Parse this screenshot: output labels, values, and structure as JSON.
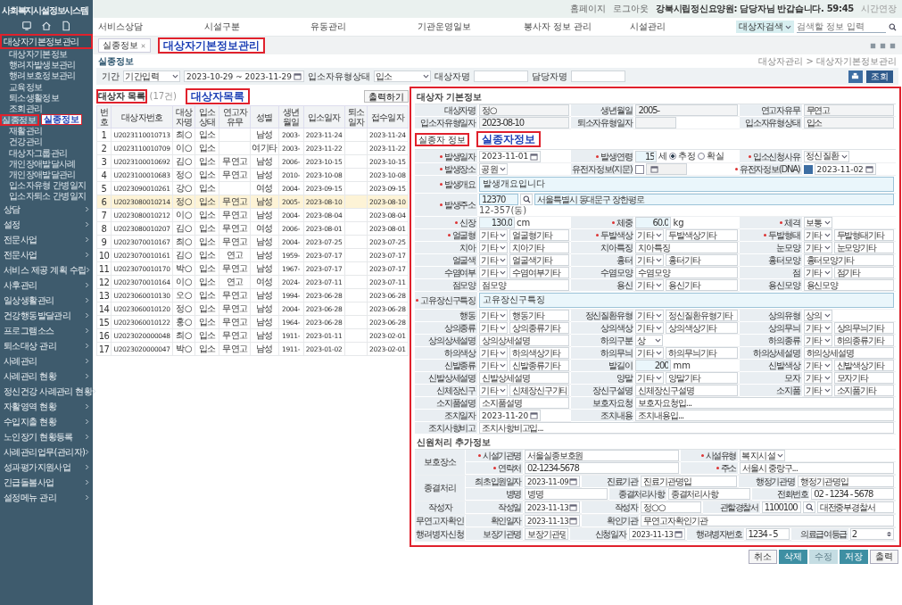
{
  "sidebar": {
    "title": "사회복지시설정보시스템",
    "items": [
      {
        "label": "대상자기본정보관리",
        "expanded": true,
        "selected": false,
        "highlighted": true,
        "callout": "대상자기본정보관리",
        "children": [
          {
            "label": "대상자기본정보",
            "selected": false,
            "highlighted": false
          },
          {
            "label": "행려자발생보관리",
            "selected": false,
            "highlighted": false
          },
          {
            "label": "행려보호정보관리",
            "selected": false,
            "highlighted": false
          },
          {
            "label": "교육정보",
            "selected": false,
            "highlighted": false
          },
          {
            "label": "퇴소생활정보",
            "selected": false,
            "highlighted": false
          },
          {
            "label": "조회관리",
            "selected": false,
            "highlighted": false
          },
          {
            "label": "실종정보",
            "selected": true,
            "highlighted": true,
            "callout": "실종정보"
          },
          {
            "label": "재활관리",
            "selected": false,
            "highlighted": false
          },
          {
            "label": "건강관리",
            "selected": false,
            "highlighted": false
          },
          {
            "label": "대상자그룹관리",
            "selected": false,
            "highlighted": false
          },
          {
            "label": "개인장애발달사례",
            "selected": false,
            "highlighted": false
          },
          {
            "label": "개인장애발달관리",
            "selected": false,
            "highlighted": false
          },
          {
            "label": "입소자유형 간병일지",
            "selected": false,
            "highlighted": false
          },
          {
            "label": "입소자퇴소 간병일지",
            "selected": false,
            "highlighted": false
          }
        ]
      },
      {
        "label": "상담",
        "expanded": false,
        "selected": false,
        "highlighted": false
      },
      {
        "label": "설정",
        "expanded": false,
        "selected": false,
        "highlighted": false
      },
      {
        "label": "전문사업",
        "expanded": false,
        "selected": false,
        "highlighted": false
      },
      {
        "label": "전문사업",
        "expanded": false,
        "selected": false,
        "highlighted": false
      },
      {
        "label": "서비스 제공 계획 수립",
        "expanded": false,
        "selected": false,
        "highlighted": false
      },
      {
        "label": "사후관리",
        "expanded": false,
        "selected": false,
        "highlighted": false
      },
      {
        "label": "일상생활관리",
        "expanded": false,
        "selected": false,
        "highlighted": false
      },
      {
        "label": "건강행동발달관리",
        "expanded": false,
        "selected": false,
        "highlighted": false
      },
      {
        "label": "프로그램소스",
        "expanded": false,
        "selected": false,
        "highlighted": false
      },
      {
        "label": "퇴소대상 관리",
        "expanded": false,
        "selected": false,
        "highlighted": false
      },
      {
        "label": "사례관리",
        "expanded": false,
        "selected": false,
        "highlighted": false
      },
      {
        "label": "사례관리 현황",
        "expanded": false,
        "selected": false,
        "highlighted": false
      },
      {
        "label": "정신건강 사례관리 현황",
        "expanded": false,
        "selected": false,
        "highlighted": false
      },
      {
        "label": "자활영역 현황",
        "expanded": false,
        "selected": false,
        "highlighted": false
      },
      {
        "label": "수입지출 현황",
        "expanded": false,
        "selected": false,
        "highlighted": false
      },
      {
        "label": "노인장기 현황등록",
        "expanded": false,
        "selected": false,
        "highlighted": false
      },
      {
        "label": "사례관리업무(관리자)",
        "expanded": false,
        "selected": false,
        "highlighted": false
      },
      {
        "label": "성과평가지원사업",
        "expanded": false,
        "selected": false,
        "highlighted": false
      },
      {
        "label": "긴급돌봄사업",
        "expanded": false,
        "selected": false,
        "highlighted": false
      },
      {
        "label": "설정메뉴 관리",
        "expanded": false,
        "selected": false,
        "highlighted": false
      }
    ]
  },
  "header": {
    "links": [
      "홈페이지",
      "로그아웃"
    ],
    "user": "강북시립정신요양원: 담당자님 반갑습니다. 59:45",
    "extend": "시간연장"
  },
  "nav": {
    "items": [
      "서비스상담",
      "시설구분",
      "유동관리",
      "기관운영일보",
      "봉사자 정보 관리",
      "시설관리"
    ],
    "search": {
      "scope": "대상자검색",
      "placeholder": "검색할 정보 입력"
    }
  },
  "tabs": [
    {
      "label": "실종정보",
      "selected": true
    }
  ],
  "page": {
    "title": "실종정보",
    "breadcrumb": "대상자관리 > 대상자기본정보관리"
  },
  "filter": {
    "period_label": "기간",
    "period": "기간입력",
    "date_range": "2023-10-29 ~ 2023-11-29",
    "status_label": "입소자유형상태",
    "status": "입소",
    "name_label": "대상자명",
    "manager_label": "담당자명",
    "search_button": "조회"
  },
  "list": {
    "title": "대상자 목록",
    "count": "(17건)",
    "highlighted": true,
    "callout": "대상자목록",
    "print_button": "출력하기",
    "columns": [
      "번호",
      "대상자번호",
      "대상자명",
      "입소상태",
      "연고자유무",
      "성별",
      "생년월일",
      "입소일자",
      "퇴소일자",
      "접수일자"
    ],
    "rows": [
      {
        "cells": [
          "1",
          "U2023110010713",
          "최○",
          "입소",
          "",
          "남성",
          "2003-",
          "2023-11-24",
          "",
          "2023-11-24"
        ],
        "selected": false
      },
      {
        "cells": [
          "2",
          "U2023110010709",
          "이○",
          "입소",
          "",
          "여기타",
          "2003-",
          "2023-11-22",
          "",
          "2023-11-22"
        ],
        "selected": false
      },
      {
        "cells": [
          "3",
          "U2023100010692",
          "김○",
          "입소",
          "무연고",
          "남성",
          "2006-",
          "2023-10-15",
          "",
          "2023-10-15"
        ],
        "selected": false
      },
      {
        "cells": [
          "4",
          "U2023100010683",
          "정○",
          "입소",
          "무연고",
          "남성",
          "2010-",
          "2023-10-08",
          "",
          "2023-10-08"
        ],
        "selected": false
      },
      {
        "cells": [
          "5",
          "U2023090010261",
          "강○",
          "입소",
          "",
          "여성",
          "2004-",
          "2023-09-15",
          "",
          "2023-09-15"
        ],
        "selected": false
      },
      {
        "cells": [
          "6",
          "U2023080010214",
          "정○",
          "입소",
          "무연고",
          "남성",
          "2005-",
          "2023-08-10",
          "",
          "2023-08-10"
        ],
        "selected": true
      },
      {
        "cells": [
          "7",
          "U2023080010212",
          "이○",
          "입소",
          "무연고",
          "남성",
          "2004-",
          "2023-08-04",
          "",
          "2023-08-04"
        ],
        "selected": false
      },
      {
        "cells": [
          "8",
          "U2023080010207",
          "김○",
          "입소",
          "무연고",
          "여성",
          "2006-",
          "2023-08-01",
          "",
          "2023-08-01"
        ],
        "selected": false
      },
      {
        "cells": [
          "9",
          "U2023070010167",
          "최○",
          "입소",
          "무연고",
          "남성",
          "2004-",
          "2023-07-25",
          "",
          "2023-07-25"
        ],
        "selected": false
      },
      {
        "cells": [
          "10",
          "U2023070010161",
          "김○",
          "입소",
          "연고",
          "남성",
          "1959-",
          "2023-07-17",
          "",
          "2023-07-17"
        ],
        "selected": false
      },
      {
        "cells": [
          "11",
          "U2023070010170",
          "박○",
          "입소",
          "무연고",
          "남성",
          "1967-",
          "2023-07-17",
          "",
          "2023-07-17"
        ],
        "selected": false
      },
      {
        "cells": [
          "12",
          "U2023070010164",
          "이○",
          "입소",
          "연고",
          "여성",
          "2024-",
          "2023-07-11",
          "",
          "2023-07-11"
        ],
        "selected": false
      },
      {
        "cells": [
          "13",
          "U2023060010130",
          "오○",
          "입소",
          "무연고",
          "남성",
          "1994-",
          "2023-06-28",
          "",
          "2023-06-28"
        ],
        "selected": false
      },
      {
        "cells": [
          "14",
          "U2023060010120",
          "정○",
          "입소",
          "무연고",
          "남성",
          "2004-",
          "2023-06-28",
          "",
          "2023-06-28"
        ],
        "selected": false
      },
      {
        "cells": [
          "15",
          "U2023060010122",
          "홍○",
          "입소",
          "무연고",
          "남성",
          "1964-",
          "2023-06-28",
          "",
          "2023-06-28"
        ],
        "selected": false
      },
      {
        "cells": [
          "16",
          "U2023020000048",
          "최○",
          "입소",
          "무연고",
          "남성",
          "1911-",
          "2023-01-11",
          "",
          "2023-02-01"
        ],
        "selected": false
      },
      {
        "cells": [
          "17",
          "U2023020000047",
          "박○",
          "입소",
          "무연고",
          "남성",
          "1911-",
          "2023-01-02",
          "",
          "2023-02-01"
        ],
        "selected": false
      }
    ]
  },
  "detail": {
    "highlighted": true,
    "basic_title": "대상자 기본정보",
    "basic_rows": [
      [
        {
          "label": "대상자명",
          "value": "정○"
        },
        {
          "label": "생년월일",
          "value": "2005-"
        },
        {
          "label": "연고자유무",
          "value": "무연고"
        }
      ],
      [
        {
          "label": "입소자유형일자",
          "value": "2023-08-10"
        },
        {
          "label": "퇴소자유형일자"
        },
        {
          "label": "입소자유형상태",
          "value": "입소"
        }
      ]
    ],
    "tab": {
      "label": "실종자 정보",
      "highlighted": true,
      "callout": "실종자정보"
    },
    "rows": [
      [
        {
          "label": "발생일자",
          "required": true,
          "kind": "date",
          "value": "2023-11-01"
        },
        {
          "label": "발생연령",
          "required": true,
          "kind": "age",
          "value": "15",
          "unit": "세",
          "options": [
            {
              "label": "추정",
              "selected": true
            },
            {
              "label": "확실",
              "selected": false
            }
          ]
        },
        {
          "label": "입소신청사유",
          "required": true,
          "kind": "select",
          "value": "정신질환"
        }
      ],
      [
        {
          "label": "발생장소",
          "required": true,
          "kind": "select",
          "value": "공원"
        },
        {
          "label": "유전자정보(지문)",
          "kind": "check_date",
          "checked": false
        },
        {
          "label": "유전자정보(DNA)",
          "required": true,
          "kind": "check_date",
          "checked": true,
          "value": "2023-11-02"
        }
      ],
      [
        {
          "label": "발생개요",
          "required": true,
          "kind": "textarea",
          "value": "발생개요입니다"
        }
      ],
      [
        {
          "label": "발생주소",
          "required": true,
          "kind": "address",
          "zip": "12370",
          "value": "서울특별시 동대문구 장한평로",
          "detail": "12-357(동)"
        }
      ],
      [
        {
          "label": "신장",
          "required": true,
          "kind": "number",
          "value": "130.0",
          "unit": "cm"
        },
        {
          "label": "체중",
          "required": true,
          "kind": "number",
          "value": "60.0",
          "unit": "kg"
        },
        {
          "label": "체격",
          "required": true,
          "kind": "select",
          "value": "보통"
        }
      ],
      [
        {
          "label": "얼굴형",
          "required": true,
          "kind": "select_text",
          "value": "기타",
          "text": "얼굴형기타"
        },
        {
          "label": "두발색상",
          "required": true,
          "kind": "select_text",
          "value": "기타",
          "text": "두발색상기타"
        },
        {
          "label": "두발형태",
          "required": true,
          "kind": "select_text",
          "value": "기타",
          "text": "두발형태기타"
        }
      ],
      [
        {
          "label": "치아",
          "kind": "select_text",
          "value": "기타",
          "text": "치아기타"
        },
        {
          "label": "치아특징",
          "kind": "text",
          "value": "치아특징"
        },
        {
          "label": "눈모양",
          "kind": "select_text",
          "value": "기타",
          "text": "눈모양기타"
        }
      ],
      [
        {
          "label": "얼굴색",
          "kind": "select_text",
          "value": "기타",
          "text": "얼굴색기타"
        },
        {
          "label": "흉터",
          "kind": "select_text",
          "value": "기타",
          "text": "흉터기타"
        },
        {
          "label": "흉터모양",
          "kind": "text",
          "value": "흉터모양기타"
        }
      ],
      [
        {
          "label": "수염여부",
          "kind": "select_text",
          "value": "기타",
          "text": "수염여부기타"
        },
        {
          "label": "수염모양",
          "kind": "text",
          "value": "수염모양"
        },
        {
          "label": "점",
          "kind": "select_text",
          "value": "기타",
          "text": "점기타"
        }
      ],
      [
        {
          "label": "점모양",
          "kind": "text",
          "value": "점모양"
        },
        {
          "label": "용신",
          "kind": "select_text",
          "value": "기타",
          "text": "용신기타"
        },
        {
          "label": "용신모양",
          "kind": "text",
          "value": "용신모양"
        }
      ],
      [
        {
          "label": "고유장신구특징",
          "required": true,
          "kind": "textarea",
          "value": "고유장신구특징"
        }
      ],
      [
        {
          "label": "행동",
          "kind": "select_text",
          "value": "기타",
          "text": "행동기타"
        },
        {
          "label": "정신질환유형",
          "kind": "select_text",
          "value": "기타",
          "text": "정신질환유형기타"
        },
        {
          "label": "상의유형",
          "kind": "select",
          "value": "상의"
        }
      ],
      [
        {
          "label": "상의종류",
          "kind": "select_text",
          "value": "기타",
          "text": "상의종류기타"
        },
        {
          "label": "상의색상",
          "kind": "select_text",
          "value": "기타",
          "text": "상의색상기타"
        },
        {
          "label": "상의무늬",
          "kind": "select_text",
          "value": "기타",
          "text": "상의무늬기타"
        }
      ],
      [
        {
          "label": "상의상세설명",
          "kind": "text",
          "value": "상의상세설명"
        },
        {
          "label": "하의구분",
          "kind": "select",
          "value": "상"
        },
        {
          "label": "하의종류",
          "kind": "select_text",
          "value": "기타",
          "text": "하의종류기타"
        }
      ],
      [
        {
          "label": "하의색상",
          "kind": "select_text",
          "value": "기타",
          "text": "하의색상기타"
        },
        {
          "label": "하의무늬",
          "kind": "select_text",
          "value": "기타",
          "text": "하의무늬기타"
        },
        {
          "label": "하의상세설명",
          "kind": "text",
          "value": "하의상세설명"
        }
      ],
      [
        {
          "label": "신발종류",
          "kind": "select_text",
          "value": "기타",
          "text": "신발종류기타"
        },
        {
          "label": "발길이",
          "kind": "number",
          "value": "200",
          "unit": "mm"
        },
        {
          "label": "신발색상",
          "kind": "select_text",
          "value": "기타",
          "text": "신발색상기타"
        }
      ],
      [
        {
          "label": "신발상세설명",
          "kind": "text",
          "value": "신발상세설명"
        },
        {
          "label": "양말",
          "kind": "select_text",
          "value": "기타",
          "text": "양말기타"
        },
        {
          "label": "모자",
          "kind": "select_text",
          "value": "기타",
          "text": "모자기타"
        }
      ],
      [
        {
          "label": "신체장신구",
          "kind": "select_text",
          "value": "기타",
          "text": "신체장신구기타"
        },
        {
          "label": "장신구설명",
          "kind": "text",
          "value": "신체장신구설명"
        },
        {
          "label": "소지품",
          "kind": "select_text",
          "value": "기타",
          "text": "소지품기타"
        }
      ],
      [
        {
          "label": "소지품설명",
          "kind": "text",
          "value": "소지품설명"
        },
        {
          "label": "보호자요청",
          "kind": "wide_text",
          "value": "보호자요청입..."
        }
      ],
      [
        {
          "label": "조치일자",
          "kind": "date",
          "value": "2023-11-20"
        },
        {
          "label": "조치내용",
          "kind": "wide_text",
          "value": "조치내용입..."
        }
      ],
      [
        {
          "label": "조치사항비고",
          "kind": "wide_text",
          "value": "조치사항비고입..."
        }
      ]
    ],
    "extra_title": "신원처리 추가정보",
    "groups": [
      {
        "label": "보호장소",
        "rows": [
          [
            {
              "label": "시설기관명",
              "required": true,
              "kind": "text",
              "value": "서울실종보호원"
            },
            {
              "label": "시설유형",
              "required": true,
              "kind": "select",
              "value": "복지시설"
            }
          ],
          [
            {
              "label": "연락처",
              "required": true,
              "kind": "text",
              "value": "02-1234-5678"
            },
            {
              "label": "주소",
              "required": true,
              "kind": "text",
              "value": "서울시 중랑구..."
            }
          ]
        ]
      },
      {
        "label": "종결처리",
        "rows": [
          [
            {
              "label": "최초입원일자",
              "kind": "date",
              "value": "2023-11-09"
            },
            {
              "label": "진료기관",
              "kind": "text",
              "value": "진료기관명입"
            },
            {
              "label": "행정기관명",
              "kind": "text",
              "value": "행정기관명입"
            }
          ],
          [
            {
              "label": "병명",
              "kind": "text",
              "value": "병명"
            },
            {
              "label": "종결처리사항",
              "kind": "text",
              "value": "종결처리사항"
            },
            {
              "label": "전화번호",
              "kind": "text",
              "value": "02 - 1234 - 5678"
            }
          ]
        ]
      },
      {
        "label": "작성자",
        "rows": [
          [
            {
              "label": "작성일",
              "kind": "date",
              "value": "2023-11-13"
            },
            {
              "label": "작성자",
              "kind": "text",
              "value": "정○○"
            },
            {
              "label": "관할경찰서",
              "kind": "lookup",
              "zip": "1100100",
              "value": "대전중부경찰서"
            }
          ]
        ]
      },
      {
        "label": "무연고자확인",
        "rows": [
          [
            {
              "label": "확인일자",
              "kind": "date",
              "value": "2023-11-13"
            },
            {
              "label": "확인기관",
              "kind": "text",
              "value": "무연고자확인기관"
            }
          ]
        ]
      },
      {
        "label": "행려병자신청",
        "rows": [
          [
            {
              "label": "보장기관명",
              "kind": "text",
              "value": "보장기관명"
            },
            {
              "label": "신청일자",
              "kind": "date",
              "value": "2023-11-13"
            },
            {
              "label": "행려병자번호",
              "kind": "text",
              "value": "1234 - 5"
            },
            {
              "label": "의료급여등급",
              "kind": "spin",
              "value": "2"
            }
          ]
        ]
      }
    ]
  },
  "footer_buttons": [
    {
      "label": "취소",
      "kind": "plain",
      "disabled": false
    },
    {
      "label": "삭제",
      "kind": "primary",
      "disabled": false
    },
    {
      "label": "수정",
      "kind": "primary",
      "disabled": true
    },
    {
      "label": "저장",
      "kind": "primary",
      "disabled": false
    },
    {
      "label": "출력",
      "kind": "plain",
      "disabled": false
    }
  ]
}
